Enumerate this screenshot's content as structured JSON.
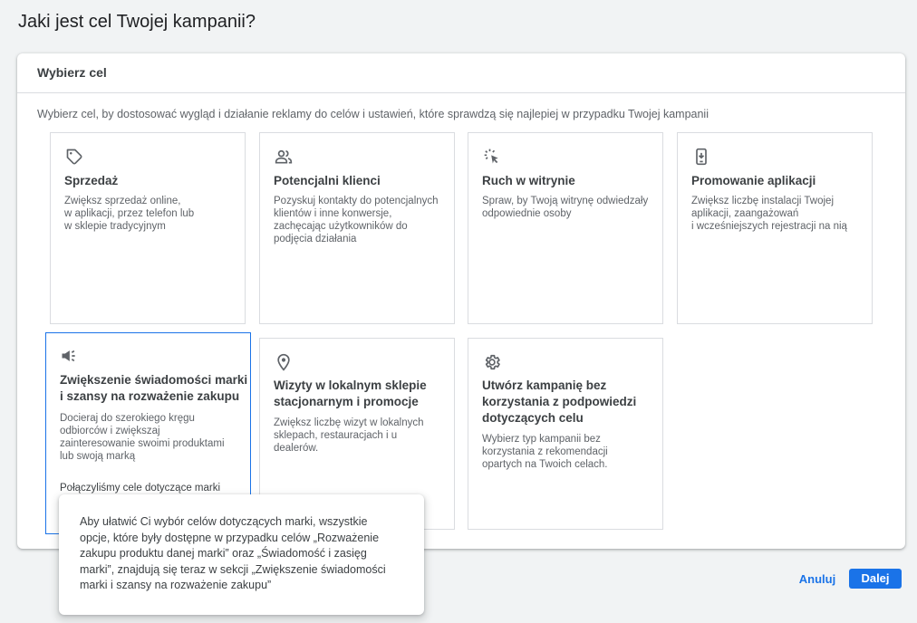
{
  "page": {
    "title": "Jaki jest cel Twojej kampanii?"
  },
  "panel": {
    "title": "Wybierz cel",
    "description": "Wybierz cel, by dostosować wygląd i działanie reklamy do celów i ustawień, które sprawdzą się najlepiej w przypadku Twojej kampanii"
  },
  "cards": [
    {
      "icon": "tag-icon",
      "title": "Sprzedaż",
      "desc": [
        "Zwiększ sprzedaż online,",
        "w aplikacji, przez telefon lub",
        "w sklepie tradycyjnym"
      ]
    },
    {
      "icon": "people-icon",
      "title": "Potencjalni klienci",
      "desc": [
        "Pozyskuj kontakty do potencjalnych",
        "klientów i inne konwersje,",
        "zachęcając użytkowników do",
        "podjęcia działania"
      ]
    },
    {
      "icon": "cursor-click-icon",
      "title": "Ruch w witrynie",
      "desc": [
        "Spraw, by Twoją witrynę odwiedzały",
        "odpowiednie osoby"
      ]
    },
    {
      "icon": "mobile-download-icon",
      "title": "Promowanie aplikacji",
      "desc": [
        "Zwiększ liczbę instalacji Twojej",
        "aplikacji, zaangażowań",
        "i wcześniejszych rejestracji na nią"
      ]
    },
    {
      "icon": "megaphone-icon",
      "title": [
        "Zwiększenie świadomości marki",
        "i szansy na rozważenie zakupu"
      ],
      "desc": [
        "Docieraj do szerokiego kręgu",
        "odbiorców i zwiększaj",
        "zainteresowanie swoimi produktami",
        "lub swoją marką"
      ],
      "note": "Połączyliśmy cele dotyczące marki",
      "selected": true
    },
    {
      "icon": "location-pin-icon",
      "title": [
        "Wizyty w lokalnym sklepie",
        "stacjonarnym i promocje"
      ],
      "desc": [
        "Zwiększ liczbę wizyt w lokalnych",
        "sklepach, restauracjach i u",
        "dealerów."
      ]
    },
    {
      "icon": "gear-icon",
      "title": [
        "Utwórz kampanię bez",
        "korzystania z podpowiedzi",
        "dotyczących celu"
      ],
      "desc": [
        "Wybierz typ kampanii bez",
        "korzystania z rekomendacji",
        "opartych na Twoich celach."
      ]
    }
  ],
  "tooltip": {
    "lines": [
      "Aby ułatwić Ci wybór celów dotyczących marki, wszystkie",
      "opcje, które były dostępne w przypadku celów „Rozważenie",
      "zakupu produktu danej marki” oraz „Świadomość i zasięg",
      "marki”, znajdują się teraz w sekcji „Zwiększenie świadomości",
      "marki i szansy na rozważenie zakupu”"
    ]
  },
  "footer": {
    "cancel_label": "Anuluj",
    "next_label": "Dalej"
  },
  "colors": {
    "accent": "#1a73e8",
    "border": "#dadce0",
    "text": "#3c4043",
    "muted": "#5f6368"
  }
}
